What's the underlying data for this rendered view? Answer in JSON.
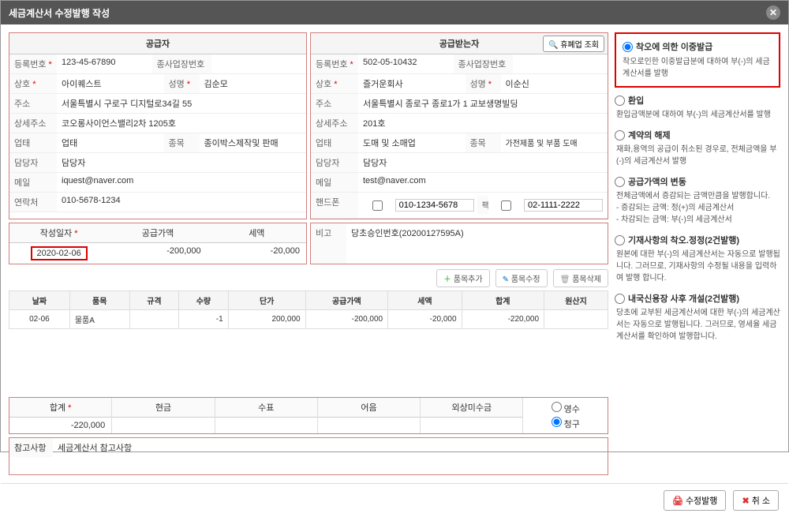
{
  "modal_title": "세금계산서 수정발행 작성",
  "supplier": {
    "header": "공급자",
    "labels": {
      "regno": "등록번호",
      "bizplace": "종사업장번호",
      "company": "상호",
      "ceo": "성명",
      "addr": "주소",
      "addr2": "상세주소",
      "biztype": "업태",
      "item": "종목",
      "manager": "담당자",
      "email": "메일",
      "contact": "연락처"
    },
    "regno": "123-45-67890",
    "bizplace": "",
    "company": "아이퀘스트",
    "ceo": "김순모",
    "addr": "서울특별시 구로구 디지털로34길 55",
    "addr2": "코오롱사이언스밸리2차 1205호",
    "biztype": "업태",
    "item": "종이박스제작및 판매",
    "manager": "담당자",
    "email": "iquest@naver.com",
    "contact": "010-5678-1234"
  },
  "buyer": {
    "header": "공급받는자",
    "lookup_btn": "휴폐업 조회",
    "labels": {
      "phone": "핸드폰",
      "fax": "팩스"
    },
    "regno": "502-05-10432",
    "bizplace": "",
    "company": "즐거운회사",
    "ceo": "이순신",
    "addr": "서울특별시 종로구 종로1가 1 교보생명빌딩",
    "addr2": "201호",
    "biztype": "도매 및 소매업",
    "item": "가전제품 및 부품 도매",
    "manager": "담당자",
    "email": "test@naver.com",
    "phone": "010-1234-5678",
    "fax": "02-1111-2222"
  },
  "summary": {
    "labels": {
      "date": "작성일자",
      "supply": "공급가액",
      "tax": "세액"
    },
    "date": "2020-02-06",
    "supply": "-200,000",
    "tax": "-20,000"
  },
  "remarks": {
    "label": "비고",
    "value": "당초승인번호(20200127595A)"
  },
  "item_actions": {
    "add": "품목추가",
    "edit": "품목수정",
    "delete": "품목삭제"
  },
  "item_table": {
    "headers": [
      "날짜",
      "품목",
      "규격",
      "수량",
      "단가",
      "공급가액",
      "세액",
      "합계",
      "원산지"
    ],
    "rows": [
      {
        "date": "02-06",
        "name": "물품A",
        "spec": "",
        "qty": "-1",
        "price": "200,000",
        "supply": "-200,000",
        "tax": "-20,000",
        "total": "-220,000",
        "origin": ""
      }
    ]
  },
  "totals": {
    "labels": {
      "sum": "합계",
      "cash": "현금",
      "check": "수표",
      "note": "어음",
      "credit": "외상미수금"
    },
    "sum": "-220,000",
    "cash": "",
    "check": "",
    "note": "",
    "credit": "",
    "radio1": "영수",
    "radio2": "청구"
  },
  "ref": {
    "label": "참고사항",
    "value": "세금계산서 참고사항"
  },
  "reasons": {
    "r1": {
      "title": "착오에 의한 이중발급",
      "desc": "착오로인한 이중발급분에 대하여 부(-)의 세금계산서를 발행"
    },
    "r2": {
      "title": "환입",
      "desc": "환입금액분에 대하여 부(-)의 세금계산서를 발행"
    },
    "r3": {
      "title": "계약의 해제",
      "desc": "재화,용역의 공급이 취소된 경우로, 전체금액을 부(-)의 세금계산서 발행"
    },
    "r4": {
      "title": "공급가액의 변동",
      "desc": "전체금액에서 증감되는 금액만큼을 발행합니다.\n- 증감되는 금액: 정(+)의 세금계산서\n- 차감되는 금액: 부(-)의 세금계산서"
    },
    "r5": {
      "title": "기재사항의 착오.정정(2건발행)",
      "desc": "원본에 대한 부(-)의 세금계산서는 자동으로 발행됩니다. 그러므로, 기재사항의 수정될 내용을 입력하여 발행 합니다."
    },
    "r6": {
      "title": "내국신용장 사후 개설(2건발행)",
      "desc": "당초에 교부된 세금계산서에 대한 부(-)의 세금계산서는 자동으로 발행됩니다. 그러므로, 영세율 세금계산서를 확인하여 발행합니다."
    }
  },
  "footer": {
    "issue": "수정발행",
    "cancel": "취 소"
  }
}
